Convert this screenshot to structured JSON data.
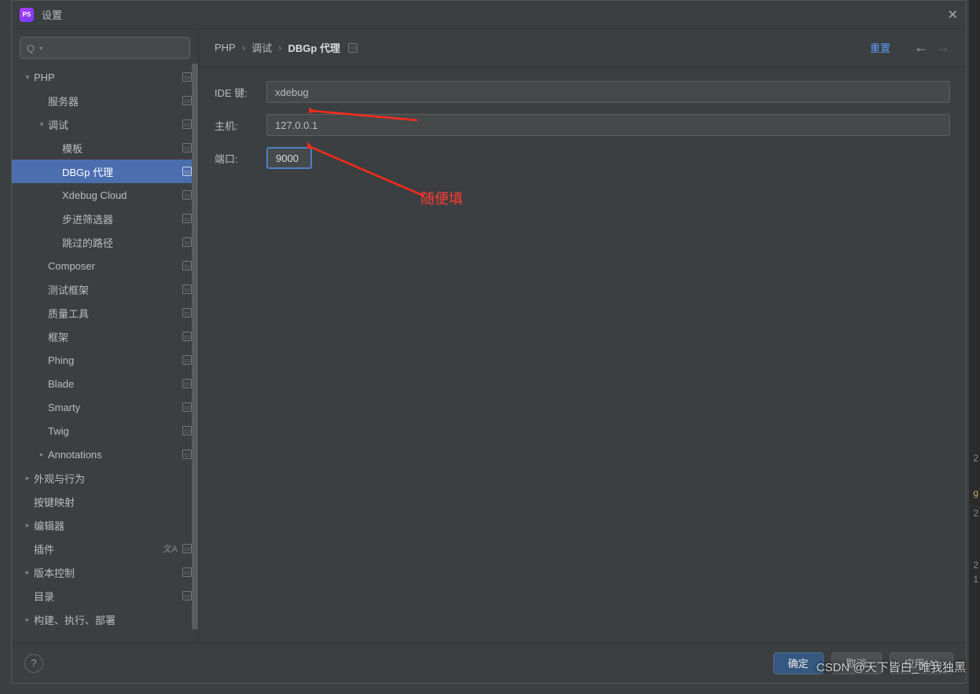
{
  "window": {
    "title": "设置"
  },
  "search": {
    "placeholder": ""
  },
  "tree": [
    {
      "label": "PHP",
      "indent": 0,
      "chev": "down",
      "badge": true
    },
    {
      "label": "服务器",
      "indent": 1,
      "badge": true
    },
    {
      "label": "调试",
      "indent": 1,
      "chev": "down",
      "badge": true
    },
    {
      "label": "模板",
      "indent": 2,
      "badge": true
    },
    {
      "label": "DBGp 代理",
      "indent": 2,
      "badge": true,
      "selected": true
    },
    {
      "label": "Xdebug Cloud",
      "indent": 2,
      "badge": true
    },
    {
      "label": "步进筛选器",
      "indent": 2,
      "badge": true
    },
    {
      "label": "跳过的路径",
      "indent": 2,
      "badge": true
    },
    {
      "label": "Composer",
      "indent": 1,
      "badge": true
    },
    {
      "label": "测试框架",
      "indent": 1,
      "badge": true
    },
    {
      "label": "质量工具",
      "indent": 1,
      "badge": true
    },
    {
      "label": "框架",
      "indent": 1,
      "badge": true
    },
    {
      "label": "Phing",
      "indent": 1,
      "badge": true
    },
    {
      "label": "Blade",
      "indent": 1,
      "badge": true
    },
    {
      "label": "Smarty",
      "indent": 1,
      "badge": true
    },
    {
      "label": "Twig",
      "indent": 1,
      "badge": true
    },
    {
      "label": "Annotations",
      "indent": 1,
      "chev": "right",
      "badge": true
    },
    {
      "label": "外观与行为",
      "indent": 0,
      "chev": "right"
    },
    {
      "label": "按键映射",
      "indent": 0
    },
    {
      "label": "编辑器",
      "indent": 0,
      "chev": "right"
    },
    {
      "label": "插件",
      "indent": 0,
      "lang": true,
      "badge": true
    },
    {
      "label": "版本控制",
      "indent": 0,
      "chev": "right",
      "badge": true
    },
    {
      "label": "目录",
      "indent": 0,
      "badge": true
    },
    {
      "label": "构建、执行、部署",
      "indent": 0,
      "chev": "right"
    }
  ],
  "breadcrumbs": {
    "a": "PHP",
    "b": "调试",
    "c": "DBGp 代理",
    "reset": "重置"
  },
  "form": {
    "ide_label": "IDE 键:",
    "ide_value": "xdebug",
    "host_label": "主机:",
    "host_value": "127.0.0.1",
    "port_label": "端口:",
    "port_value": "9000"
  },
  "annotation": {
    "text": "随便填"
  },
  "footer": {
    "ok": "确定",
    "cancel": "取消",
    "apply": "应用(A)"
  },
  "watermark": "CSDN @天下皆白_唯我独黑"
}
